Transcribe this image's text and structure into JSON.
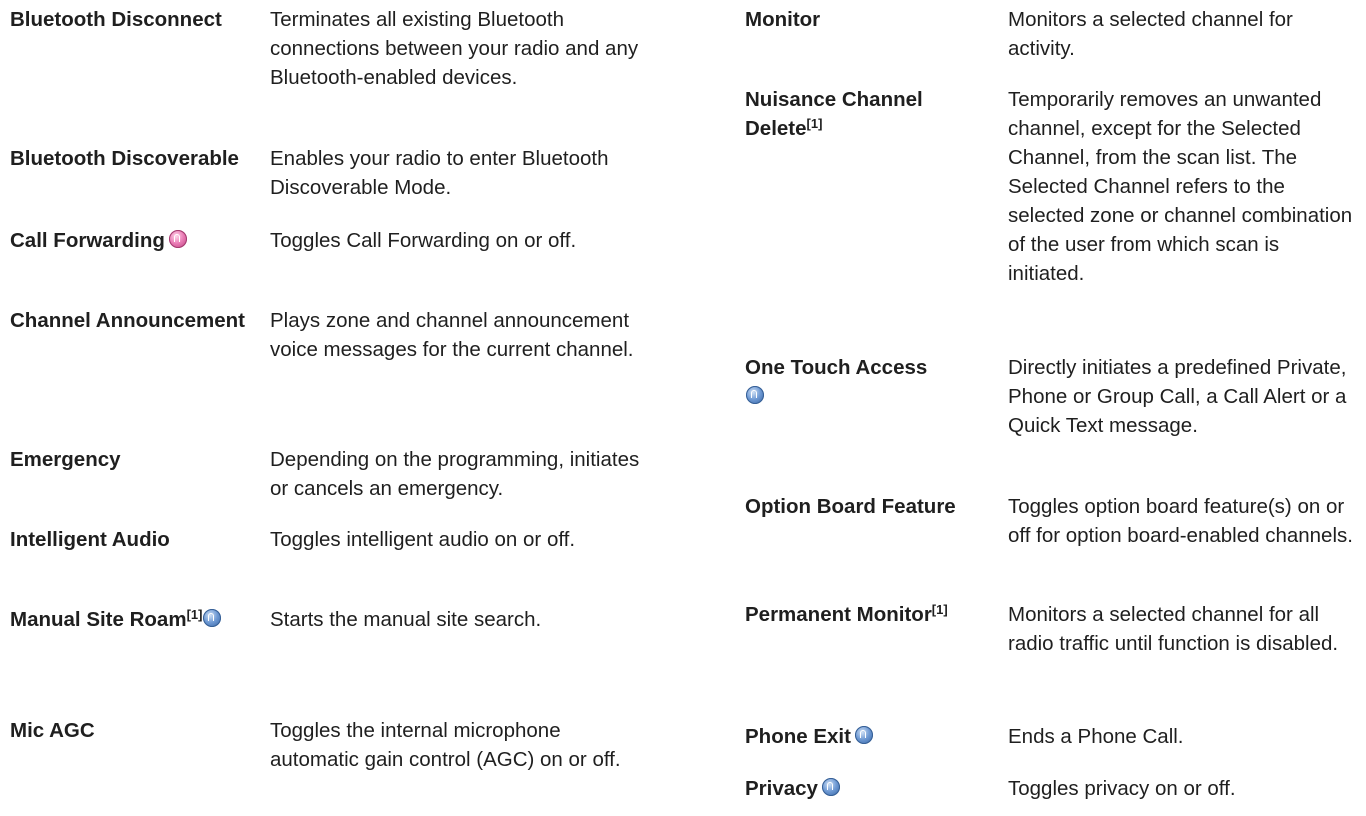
{
  "left_column": [
    {
      "term": "Bluetooth Disconnect",
      "desc": "Terminates all existing Bluetooth connections between your radio and any Bluetooth-enabled devices."
    },
    {
      "term": "Bluetooth Discoverable",
      "desc": "Enables your radio to enter Bluetooth Discoverable Mode."
    },
    {
      "term": "Call Forwarding",
      "desc": "Toggles Call Forwarding on or off."
    },
    {
      "term": "Channel Announcement",
      "desc": "Plays zone and channel announcement voice messages for the current channel."
    },
    {
      "term": "Emergency",
      "desc": "Depending on the programming, initiates or cancels an emergency."
    },
    {
      "term": "Intelligent Audio",
      "desc": "Toggles intelligent audio on or off."
    },
    {
      "term": "Manual Site Roam",
      "sup": "[1]",
      "desc": "Starts the manual site search."
    },
    {
      "term": "Mic AGC",
      "desc": "Toggles the internal microphone automatic gain control (AGC) on or off."
    }
  ],
  "right_column": [
    {
      "term": "Monitor",
      "desc": "Monitors a selected channel for activity."
    },
    {
      "term": "Nuisance Channel Delete",
      "sup": "[1]",
      "desc": "Temporarily removes an unwanted channel, except for the Selected Channel, from the scan list. The Selected Channel refers to the selected zone or channel combination of the user from which scan is initiated."
    },
    {
      "term": "One Touch Access",
      "desc": "Directly initiates a predefined Private, Phone or Group Call, a Call Alert or a Quick Text message."
    },
    {
      "term": "Option Board Feature",
      "desc": "Toggles option board feature(s) on or off for option board-enabled channels."
    },
    {
      "term": "Permanent Monitor",
      "sup": "[1]",
      "desc": "Monitors a selected channel for all radio traffic until function is disabled."
    },
    {
      "term": "Phone Exit",
      "desc": "Ends a Phone Call."
    },
    {
      "term": "Privacy",
      "desc": "Toggles privacy on or off."
    }
  ],
  "icons": {
    "call_forwarding": "pink-feature-icon",
    "blue_feature": "blue-feature-icon",
    "pink_color": "#e06aa8",
    "blue_color": "#4a78b8"
  }
}
